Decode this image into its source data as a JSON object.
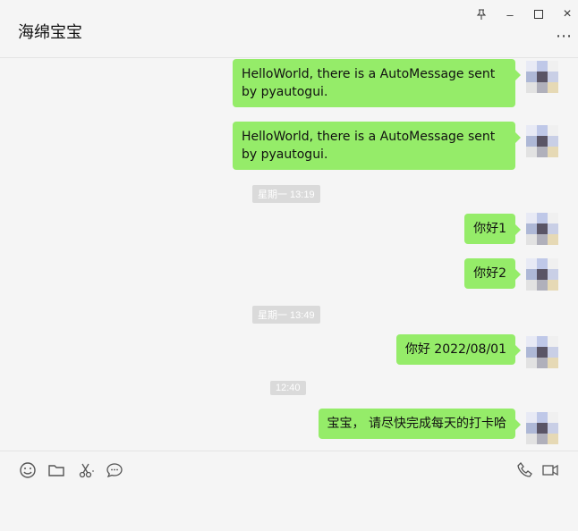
{
  "window": {
    "title": "海绵宝宝",
    "pin_icon": "pin-icon",
    "minimize_label": "–",
    "maximize_label": "☐",
    "close_label": "×",
    "more_label": "⋯"
  },
  "messages": [
    {
      "text": "HelloWorld, there is a AutoMessage sent by pyautogui.",
      "side": "right"
    },
    {
      "text": "HelloWorld, there is a AutoMessage sent by pyautogui.",
      "side": "right"
    },
    {
      "text": "你好1",
      "side": "right"
    },
    {
      "text": "你好2",
      "side": "right"
    },
    {
      "text": "你好 2022/08/01",
      "side": "right"
    },
    {
      "text": "宝宝， 请尽快完成每天的打卡哈",
      "side": "right"
    }
  ],
  "timestamps": [
    "星期一 13:19",
    "星期一 13:49",
    "12:40"
  ],
  "toolbar": {
    "emoji_icon": "emoji-icon",
    "folder_icon": "folder-icon",
    "scissors_icon": "scissors-icon",
    "chat_history_icon": "chat-bubble-icon",
    "phone_icon": "phone-icon",
    "video_icon": "video-icon"
  },
  "colors": {
    "bubble": "#95ec69",
    "background": "#f5f5f5",
    "timestamp_bg": "#dadada"
  }
}
